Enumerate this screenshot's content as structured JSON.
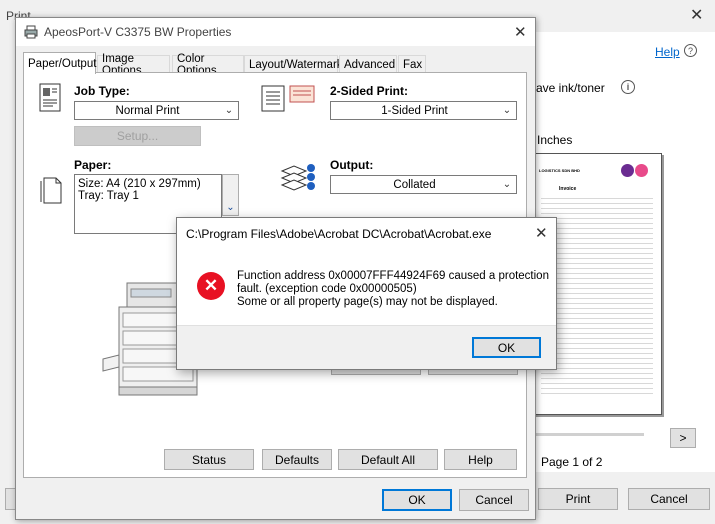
{
  "print_window": {
    "title": "Print",
    "help_link": "Help",
    "save_ink_label": "ave ink/toner",
    "units_label": "Inches",
    "page_indicator": "Page 1 of 2",
    "print_button": "Print",
    "cancel_button": "Cancel",
    "next_page_button": ">",
    "preview_doc": {
      "company": "LOGISTICS SDN BHD",
      "heading": "Invoice"
    }
  },
  "properties_dialog": {
    "title": "ApeosPort-V C3375 BW Properties",
    "tabs": [
      "Paper/Output",
      "Image Options",
      "Color Options",
      "Layout/Watermark",
      "Advanced",
      "Fax"
    ],
    "job_type_label": "Job Type:",
    "job_type_value": "Normal Print",
    "setup_button": "Setup...",
    "two_sided_label": "2-Sided Print:",
    "two_sided_value": "1-Sided Print",
    "paper_label": "Paper:",
    "paper_size": "Size: A4 (210 x 297mm)",
    "paper_tray": "Tray: Tray 1",
    "output_label": "Output:",
    "output_value": "Collated",
    "status_button": "Status",
    "defaults_button": "Defaults",
    "default_all_button": "Default All",
    "help_button": "Help",
    "ok_button": "OK",
    "cancel_button": "Cancel"
  },
  "error_dialog": {
    "title": "C:\\Program Files\\Adobe\\Acrobat DC\\Acrobat\\Acrobat.exe",
    "line1": "Function address 0x00007FFF44924F69 caused a protection",
    "line2": "fault. (exception code 0x00000505)",
    "line3": "Some or all property page(s) may not be displayed.",
    "ok_button": "OK"
  },
  "colors": {
    "accent": "#0078d7",
    "error_red": "#e81123",
    "link": "#0066cc"
  }
}
